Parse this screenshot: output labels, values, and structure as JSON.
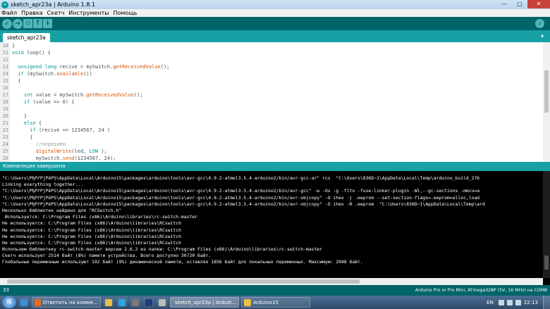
{
  "window": {
    "title": "sketch_apr23a | Arduino 1.8.1",
    "app_icon": "arduino-icon",
    "controls": [
      "minimize-icon",
      "maximize-icon",
      "close-icon"
    ]
  },
  "menu": [
    "Файл",
    "Правка",
    "Скетч",
    "Инструменты",
    "Помощь"
  ],
  "toolbar": {
    "buttons": [
      {
        "name": "verify",
        "icon": "check-icon",
        "glyph": "✓"
      },
      {
        "name": "upload",
        "icon": "arrow-right-icon",
        "glyph": "→"
      },
      {
        "name": "new",
        "icon": "new-file-icon",
        "glyph": "▫"
      },
      {
        "name": "open",
        "icon": "arrow-up-icon",
        "glyph": "↑"
      },
      {
        "name": "save",
        "icon": "arrow-down-icon",
        "glyph": "↓"
      }
    ],
    "serial_monitor_icon": "magnifier-icon"
  },
  "tab": {
    "label": "sketch_apr23a",
    "menu_icon": "chevron-down-icon"
  },
  "editor": {
    "lines": [
      {
        "n": "10",
        "parts": [
          {
            "t": "}",
            "c": ""
          }
        ]
      },
      {
        "n": "11",
        "parts": [
          {
            "t": "void",
            "c": "kw"
          },
          {
            "t": " loop() {",
            "c": ""
          }
        ]
      },
      {
        "n": "12",
        "parts": [
          {
            "t": "",
            "c": ""
          }
        ]
      },
      {
        "n": "13",
        "parts": [
          {
            "t": "  ",
            "c": ""
          },
          {
            "t": "unsigned long",
            "c": "kw"
          },
          {
            "t": " recive = mySwitch.",
            "c": ""
          },
          {
            "t": "getReceivedValue",
            "c": "fn"
          },
          {
            "t": "();",
            "c": ""
          }
        ]
      },
      {
        "n": "14",
        "parts": [
          {
            "t": "  ",
            "c": ""
          },
          {
            "t": "if",
            "c": "kw"
          },
          {
            "t": " (mySwitch.",
            "c": ""
          },
          {
            "t": "available",
            "c": "fn"
          },
          {
            "t": "())",
            "c": ""
          }
        ]
      },
      {
        "n": "15",
        "parts": [
          {
            "t": "  {",
            "c": ""
          }
        ]
      },
      {
        "n": "16",
        "parts": [
          {
            "t": "",
            "c": ""
          }
        ]
      },
      {
        "n": "17",
        "parts": [
          {
            "t": "    ",
            "c": ""
          },
          {
            "t": "int",
            "c": "kw"
          },
          {
            "t": " value = mySwitch.",
            "c": ""
          },
          {
            "t": "getReceivedValue",
            "c": "fn"
          },
          {
            "t": "();",
            "c": ""
          }
        ]
      },
      {
        "n": "18",
        "parts": [
          {
            "t": "    ",
            "c": ""
          },
          {
            "t": "if",
            "c": "kw"
          },
          {
            "t": " (value == 0) {",
            "c": ""
          }
        ]
      },
      {
        "n": "19",
        "parts": [
          {
            "t": "",
            "c": ""
          }
        ]
      },
      {
        "n": "20",
        "parts": [
          {
            "t": "    }",
            "c": ""
          }
        ]
      },
      {
        "n": "21",
        "parts": [
          {
            "t": "    ",
            "c": ""
          },
          {
            "t": "else",
            "c": "kw"
          },
          {
            "t": " {",
            "c": ""
          }
        ]
      },
      {
        "n": "22",
        "parts": [
          {
            "t": "      ",
            "c": ""
          },
          {
            "t": "if",
            "c": "kw"
          },
          {
            "t": " (recive == 1234567, 24 )",
            "c": ""
          }
        ]
      },
      {
        "n": "23",
        "parts": [
          {
            "t": "      {",
            "c": ""
          }
        ]
      },
      {
        "n": "24",
        "parts": [
          {
            "t": "        ",
            "c": ""
          },
          {
            "t": "//передаём",
            "c": "cm"
          }
        ]
      },
      {
        "n": "25",
        "parts": [
          {
            "t": "        ",
            "c": ""
          },
          {
            "t": "digitalWrite",
            "c": "fn"
          },
          {
            "t": "(led, ",
            "c": ""
          },
          {
            "t": "LOW",
            "c": "cn"
          },
          {
            "t": " );",
            "c": ""
          }
        ]
      },
      {
        "n": "26",
        "parts": [
          {
            "t": "        mySwitch.",
            "c": ""
          },
          {
            "t": "send",
            "c": "fn"
          },
          {
            "t": "(1234567, 24);",
            "c": ""
          }
        ]
      }
    ]
  },
  "status": {
    "message": "Компиляция завершена"
  },
  "console": {
    "lines": [
      "\"C:\\Users\\РђРґРјРёРЅ\\AppData\\Local\\Arduino15\\packages\\arduino\\tools\\avr-gcc\\4.9.2-atmel3.5.4-arduino2/bin/avr-gcc-ar\" rcs  \"C:\\Users\\836D~1\\AppData\\Local\\Temp\\arduino_build_276",
      "Linking everything together...",
      "\"C:\\Users\\РђРґРјРёРЅ\\AppData\\Local\\Arduino15\\packages\\arduino\\tools\\avr-gcc\\4.9.2-atmel3.5.4-arduino2/bin/avr-gcc\" -w -Os -g -flto -fuse-linker-plugin -Wl,--gc-sections -mmcu=a",
      "\"C:\\Users\\РђРґРјРёРЅ\\AppData\\Local\\Arduino15\\packages\\arduino\\tools\\avr-gcc\\4.9.2-atmel3.5.4-arduino2/bin/avr-objcopy\" -O ihex -j .eeprom --set-section-flags=.eeprom=alloc,load",
      "\"C:\\Users\\РђРґРјРёРЅ\\AppData\\Local\\Arduino15\\packages\\arduino\\tools\\avr-gcc\\4.9.2-atmel3.5.4-arduino2/bin/avr-objcopy\" -O ihex -R .eeprom  \"C:\\Users\\836D~1\\AppData\\Local\\Temp\\ard",
      "Несколько библиотек найдено для \"RCSwitch.h\"",
      " Используется: C:\\Program Files (x86)\\Arduino\\libraries\\rc-switch-master",
      "Не используется: C:\\Program Files (x86)\\Arduino\\libraries\\RCswitch",
      "Не используется: C:\\Program Files (x86)\\Arduino\\libraries\\RCswitch",
      "Не используется: C:\\Program Files (x86)\\Arduino\\libraries\\RCswitch",
      "Не используется: C:\\Program Files (x86)\\Arduino\\libraries\\RCswitch",
      "Использем библиотеку rc-switch-master версии 2.6.2 из папки: C:\\Program Files (x86)\\Arduino\\libraries\\rc-switch-master",
      "Скетч использует 2514 байт (8%) памяти устройства. Всего доступно 30720 байт.",
      "Глобальные переменные используют 192 байт (9%) динамической памяти, оставляя 1856 байт для локальных переменных. Максимум: 2048 байт."
    ]
  },
  "footer": {
    "line_number": "33",
    "board": "Arduino Pro or Pro Mini, ATmega328P (5V, 16 MHz) на COM8"
  },
  "taskbar": {
    "start_icon": "windows-start-icon",
    "tasks": [
      {
        "label": "",
        "icon": "ie-icon",
        "color": "#3b8fd9",
        "wide": false
      },
      {
        "label": "Ответить на комме...",
        "icon": "firefox-icon",
        "color": "#e66b1f",
        "wide": true,
        "active": false
      },
      {
        "label": "",
        "icon": "folder-icon",
        "color": "#e8c04a",
        "wide": false
      },
      {
        "label": "",
        "icon": "skype-icon",
        "color": "#2aa7e0",
        "wide": false
      },
      {
        "label": "",
        "icon": "player-icon",
        "color": "#7a7a7a",
        "wide": false
      },
      {
        "label": "",
        "icon": "photoshop-icon",
        "color": "#1f3d7a",
        "wide": false
      },
      {
        "label": "",
        "icon": "paint-icon",
        "color": "#bbbbbb",
        "wide": false
      },
      {
        "label": "sketch_apr23a | Arduin...",
        "icon": "arduino-icon",
        "color": "#00979c",
        "wide": true,
        "active": true
      },
      {
        "label": "Arduino15",
        "icon": "folder-icon",
        "color": "#e8c04a",
        "wide": true,
        "active": false
      }
    ],
    "tray": {
      "language": "EN",
      "time": "22:13"
    }
  }
}
